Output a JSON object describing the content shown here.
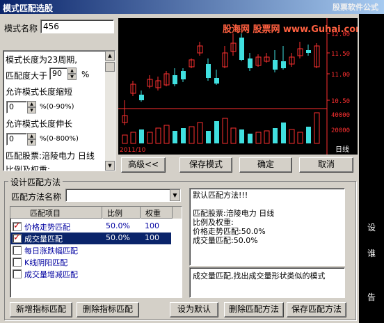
{
  "title": "模式匹配选股",
  "watermark": "股票软件公式",
  "watermark_site": "股海网 股票网 www.Guhai.com.cn",
  "pattern_name_label": "模式名称",
  "pattern_name_value": "456",
  "info_text": "模式长度为23周期,",
  "match_degree_label": "匹配度大于",
  "match_degree_value": "90",
  "match_degree_unit": "%",
  "shrink_label": "允许模式长度缩短",
  "shrink_value": "0",
  "shrink_unit": "%(0-90%)",
  "extend_label": "允许模式长度伸长",
  "extend_value": "0",
  "extend_unit": "%(0-800%)",
  "match_stock_label": "匹配股票:涪陵电力 日线",
  "ratio_weight_label": "比例及权重:",
  "chart": {
    "date_label": "2011/10",
    "period_label": "日线",
    "price_ticks": [
      "12.00",
      "11.50",
      "11.00",
      "10.50"
    ],
    "volume_ticks": [
      "40000",
      "20000"
    ]
  },
  "buttons": {
    "advanced": "高级<<",
    "save_pattern": "保存模式",
    "ok": "确定",
    "cancel": "取消",
    "add_indicator": "新增指标匹配",
    "delete_indicator": "删除指标匹配",
    "set_default": "设为默认",
    "delete_method": "删除匹配方法",
    "save_method": "保存匹配方法"
  },
  "design_group_label": "设计匹配方法",
  "method_name_label": "匹配方法名称",
  "method_name_value": "",
  "table": {
    "headers": [
      "匹配项目",
      "比例",
      "权重"
    ],
    "rows": [
      {
        "name": "价格走势匹配",
        "ratio": "50.0%",
        "weight": "100",
        "checked": true,
        "selected": false
      },
      {
        "name": "成交量匹配",
        "ratio": "50.0%",
        "weight": "100",
        "checked": true,
        "selected": true
      },
      {
        "name": "每日涨跌幅匹配",
        "ratio": "",
        "weight": "",
        "checked": false,
        "selected": false
      },
      {
        "name": "K线阴阳匹配",
        "ratio": "",
        "weight": "",
        "checked": false,
        "selected": false
      },
      {
        "name": "成交量增减匹配",
        "ratio": "",
        "weight": "",
        "checked": false,
        "selected": false
      }
    ]
  },
  "default_text": {
    "line1": "默认匹配方法!!!",
    "line2": "匹配股票:涪陵电力 日线",
    "line3": "比例及权重:",
    "line4": "价格走势匹配:50.0%",
    "line5": "成交量匹配:50.0%"
  },
  "desc_text": "成交量匹配,找出成交量形状类似的模式",
  "right_strip_text": [
    "设",
    "谁",
    "告"
  ],
  "colors": {
    "up": "#ff3030",
    "down": "#40e0e0",
    "bg": "#000000"
  }
}
